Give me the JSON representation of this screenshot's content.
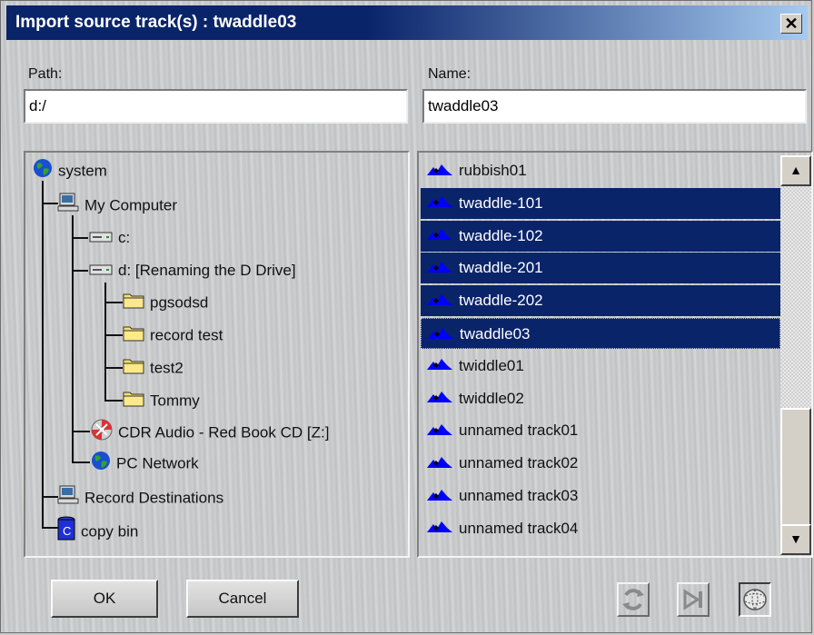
{
  "window": {
    "title": "Import source track(s) : twaddle03"
  },
  "path": {
    "label": "Path:",
    "value": "d:/"
  },
  "name": {
    "label": "Name:",
    "value": "twaddle03"
  },
  "tree": [
    {
      "label": "system",
      "icon": "globe-icon"
    },
    {
      "label": "My Computer",
      "icon": "computer-icon"
    },
    {
      "label": "c:",
      "icon": "drive-icon"
    },
    {
      "label": "d: [Renaming the D Drive]",
      "icon": "drive-icon"
    },
    {
      "label": "pgsodsd",
      "icon": "folder-icon"
    },
    {
      "label": "record test",
      "icon": "folder-icon"
    },
    {
      "label": "test2",
      "icon": "folder-icon"
    },
    {
      "label": "Tommy",
      "icon": "folder-icon"
    },
    {
      "label": "CDR Audio - Red Book CD [Z:]",
      "icon": "cd-icon"
    },
    {
      "label": "PC Network",
      "icon": "globe-icon"
    },
    {
      "label": "Record Destinations",
      "icon": "computer-icon"
    },
    {
      "label": "copy bin",
      "icon": "bin-icon"
    }
  ],
  "tracks": [
    {
      "label": "rubbish01",
      "selected": false
    },
    {
      "label": "twaddle-101",
      "selected": true
    },
    {
      "label": "twaddle-102",
      "selected": true
    },
    {
      "label": "twaddle-201",
      "selected": true
    },
    {
      "label": "twaddle-202",
      "selected": true
    },
    {
      "label": "twaddle03",
      "selected": true
    },
    {
      "label": "twiddle01",
      "selected": false
    },
    {
      "label": "twiddle02",
      "selected": false
    },
    {
      "label": "unnamed track01",
      "selected": false
    },
    {
      "label": "unnamed track02",
      "selected": false
    },
    {
      "label": "unnamed track03",
      "selected": false
    },
    {
      "label": "unnamed track04",
      "selected": false
    }
  ],
  "buttons": {
    "ok": "OK",
    "cancel": "Cancel"
  },
  "colors": {
    "selection": "#0a246a",
    "title_bar": "#0a246a",
    "track_icon": "#0000ff"
  }
}
